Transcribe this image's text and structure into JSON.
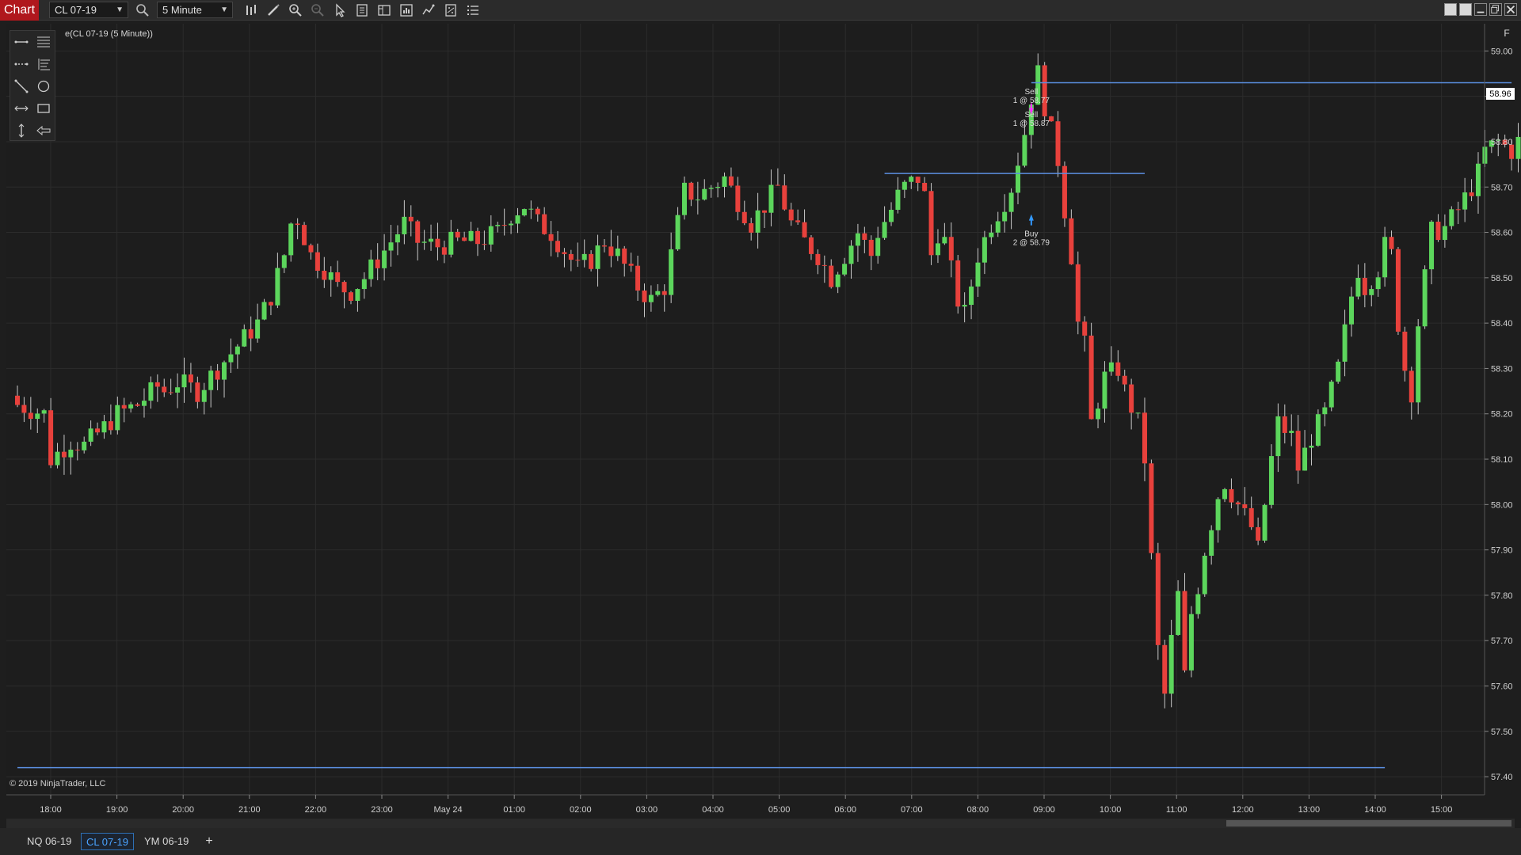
{
  "toolbar": {
    "chart_label": "Chart",
    "instrument": "CL 07-19",
    "interval": "5 Minute",
    "icons": [
      "magnifier-icon",
      "bar-chart-icon",
      "pencil-icon",
      "zoom-in-icon",
      "zoom-out-icon",
      "pointer-icon",
      "data-box-icon",
      "template-icon",
      "properties-icon",
      "strategy-icon",
      "indicators-icon",
      "list-icon"
    ]
  },
  "chart": {
    "instrument_label": "e(CL 07-19 (5 Minute))",
    "copyright": "© 2019 NinjaTrader, LLC",
    "f_button": "F",
    "current_price_label": "58.96",
    "colors": {
      "background": "#1d1d1d",
      "up": "#5cd65c",
      "down": "#e8413c",
      "line": "#5b8fe0",
      "grid": "#2c2c2c",
      "price_marker": "#ffffff"
    }
  },
  "chart_data": {
    "type": "candlestick",
    "ylim": [
      57.36,
      59.06
    ],
    "y_ticks": [
      57.4,
      57.5,
      57.6,
      57.7,
      57.8,
      57.9,
      58.0,
      58.1,
      58.2,
      58.3,
      58.4,
      58.5,
      58.6,
      58.7,
      58.8,
      58.9,
      59.0
    ],
    "y_tick_labels": [
      "57.40",
      "57.50",
      "57.60",
      "57.70",
      "57.80",
      "57.90",
      "58.00",
      "58.10",
      "58.20",
      "58.30",
      "58.40",
      "58.50",
      "58.60",
      "58.70",
      "58.80",
      "58.90",
      "59.00"
    ],
    "x_tick_labels": [
      "18:00",
      "19:00",
      "20:00",
      "21:00",
      "22:00",
      "23:00",
      "May 24",
      "01:00",
      "02:00",
      "03:00",
      "04:00",
      "05:00",
      "06:00",
      "07:00",
      "08:00",
      "09:00",
      "10:00",
      "11:00",
      "12:00",
      "13:00",
      "14:00",
      "15:00"
    ],
    "anchors": [
      [
        0,
        58.22
      ],
      [
        4,
        58.2
      ],
      [
        5,
        58.1
      ],
      [
        8,
        58.14
      ],
      [
        10,
        58.13
      ],
      [
        13,
        58.17
      ],
      [
        15,
        58.2
      ],
      [
        18,
        58.22
      ],
      [
        21,
        58.26
      ],
      [
        22,
        58.25
      ],
      [
        24,
        58.27
      ],
      [
        27,
        58.25
      ],
      [
        30,
        58.3
      ],
      [
        33,
        58.35
      ],
      [
        36,
        58.4
      ],
      [
        38,
        58.46
      ],
      [
        40,
        58.55
      ],
      [
        41,
        58.62
      ],
      [
        42,
        58.63
      ],
      [
        44,
        58.55
      ],
      [
        46,
        58.52
      ],
      [
        48,
        58.48
      ],
      [
        50,
        58.47
      ],
      [
        52,
        58.5
      ],
      [
        54,
        58.54
      ],
      [
        56,
        58.58
      ],
      [
        58,
        58.62
      ],
      [
        60,
        58.58
      ],
      [
        63,
        58.57
      ],
      [
        66,
        58.58
      ],
      [
        69,
        58.58
      ],
      [
        72,
        58.6
      ],
      [
        74,
        58.64
      ],
      [
        76,
        58.66
      ],
      [
        78,
        58.62
      ],
      [
        80,
        58.6
      ],
      [
        82,
        58.56
      ],
      [
        84,
        58.52
      ],
      [
        86,
        58.54
      ],
      [
        88,
        58.58
      ],
      [
        90,
        58.55
      ],
      [
        93,
        58.48
      ],
      [
        95,
        58.45
      ],
      [
        97,
        58.48
      ],
      [
        98,
        58.55
      ],
      [
        99,
        58.62
      ],
      [
        100,
        58.69
      ],
      [
        102,
        58.68
      ],
      [
        104,
        58.7
      ],
      [
        106,
        58.72
      ],
      [
        108,
        58.67
      ],
      [
        110,
        58.62
      ],
      [
        112,
        58.66
      ],
      [
        114,
        58.7
      ],
      [
        116,
        58.62
      ],
      [
        118,
        58.58
      ],
      [
        120,
        58.55
      ],
      [
        122,
        58.5
      ],
      [
        124,
        58.55
      ],
      [
        126,
        58.6
      ],
      [
        128,
        58.55
      ],
      [
        129,
        58.6
      ],
      [
        131,
        58.65
      ],
      [
        132,
        58.68
      ],
      [
        133,
        58.7
      ],
      [
        135,
        58.72
      ],
      [
        136,
        58.68
      ],
      [
        137,
        58.55
      ],
      [
        138,
        58.6
      ],
      [
        139,
        58.58
      ],
      [
        141,
        58.45
      ],
      [
        142,
        58.42
      ],
      [
        144,
        58.55
      ],
      [
        146,
        58.62
      ],
      [
        148,
        58.67
      ],
      [
        149,
        58.7
      ],
      [
        150,
        58.76
      ],
      [
        151,
        58.82
      ],
      [
        152,
        58.9
      ],
      [
        153,
        58.95
      ],
      [
        154,
        58.88
      ],
      [
        155,
        58.82
      ],
      [
        156,
        58.76
      ],
      [
        157,
        58.65
      ],
      [
        158,
        58.55
      ],
      [
        159,
        58.4
      ],
      [
        160,
        58.35
      ],
      [
        161,
        58.18
      ],
      [
        163,
        58.28
      ],
      [
        165,
        58.3
      ],
      [
        166,
        58.25
      ],
      [
        168,
        58.18
      ],
      [
        169,
        58.1
      ],
      [
        170,
        57.88
      ],
      [
        171,
        57.68
      ],
      [
        172,
        57.58
      ],
      [
        173,
        57.7
      ],
      [
        174,
        57.8
      ],
      [
        175,
        57.62
      ],
      [
        176,
        57.76
      ],
      [
        177,
        57.82
      ],
      [
        178,
        57.9
      ],
      [
        180,
        58.02
      ],
      [
        181,
        58.05
      ],
      [
        183,
        58.0
      ],
      [
        185,
        57.95
      ],
      [
        186,
        57.9
      ],
      [
        187,
        58.0
      ],
      [
        188,
        58.1
      ],
      [
        189,
        58.18
      ],
      [
        191,
        58.15
      ],
      [
        192,
        58.08
      ],
      [
        194,
        58.15
      ],
      [
        196,
        58.2
      ],
      [
        198,
        58.3
      ],
      [
        199,
        58.38
      ],
      [
        200,
        58.46
      ],
      [
        201,
        58.52
      ],
      [
        202,
        58.48
      ],
      [
        204,
        58.52
      ],
      [
        205,
        58.57
      ],
      [
        206,
        58.55
      ],
      [
        207,
        58.4
      ],
      [
        208,
        58.3
      ],
      [
        209,
        58.25
      ],
      [
        210,
        58.4
      ],
      [
        211,
        58.5
      ],
      [
        212,
        58.6
      ],
      [
        214,
        58.61
      ],
      [
        216,
        58.65
      ],
      [
        218,
        58.7
      ],
      [
        219,
        58.73
      ],
      [
        220,
        58.78
      ],
      [
        222,
        58.8
      ],
      [
        224,
        58.78
      ],
      [
        225,
        58.8
      ],
      [
        226,
        58.85
      ],
      [
        227,
        58.92
      ],
      [
        228,
        58.95
      ],
      [
        229,
        58.97
      ]
    ],
    "lines": [
      {
        "price": 58.73,
        "from_bar": 130,
        "to_bar": 169
      },
      {
        "price": 58.93,
        "from_bar": 152,
        "to_bar": 224
      },
      {
        "price": 57.42,
        "from_bar": 0,
        "to_bar": 205
      }
    ],
    "executions": [
      {
        "bar": 152,
        "side": "Sell",
        "text": "1 @ 58.77",
        "price": 58.86
      },
      {
        "bar": 152,
        "side": "Sell",
        "text": "1 @ 58.87",
        "price": 58.86
      },
      {
        "bar": 152,
        "side": "Buy",
        "text": "2 @ 58.79",
        "price": 58.64
      }
    ]
  },
  "bottom": {
    "tabs": [
      {
        "label": "NQ 06-19",
        "active": false
      },
      {
        "label": "CL 07-19",
        "active": true
      },
      {
        "label": "YM 06-19",
        "active": false
      }
    ],
    "add_tab": "+"
  }
}
